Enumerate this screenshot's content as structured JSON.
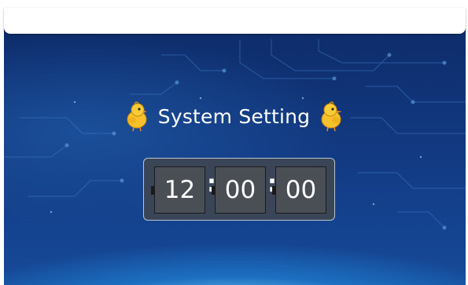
{
  "header": {
    "title": "System Setting"
  },
  "clock": {
    "hours": "12",
    "minutes": "00",
    "seconds": "00",
    "separator": ":"
  },
  "icons": {
    "left": "chick-icon",
    "right": "chick-icon"
  },
  "colors": {
    "background": "#133c86",
    "panel": "#3e4654",
    "digit_box": "#4a4f56",
    "text": "#ffffff"
  }
}
